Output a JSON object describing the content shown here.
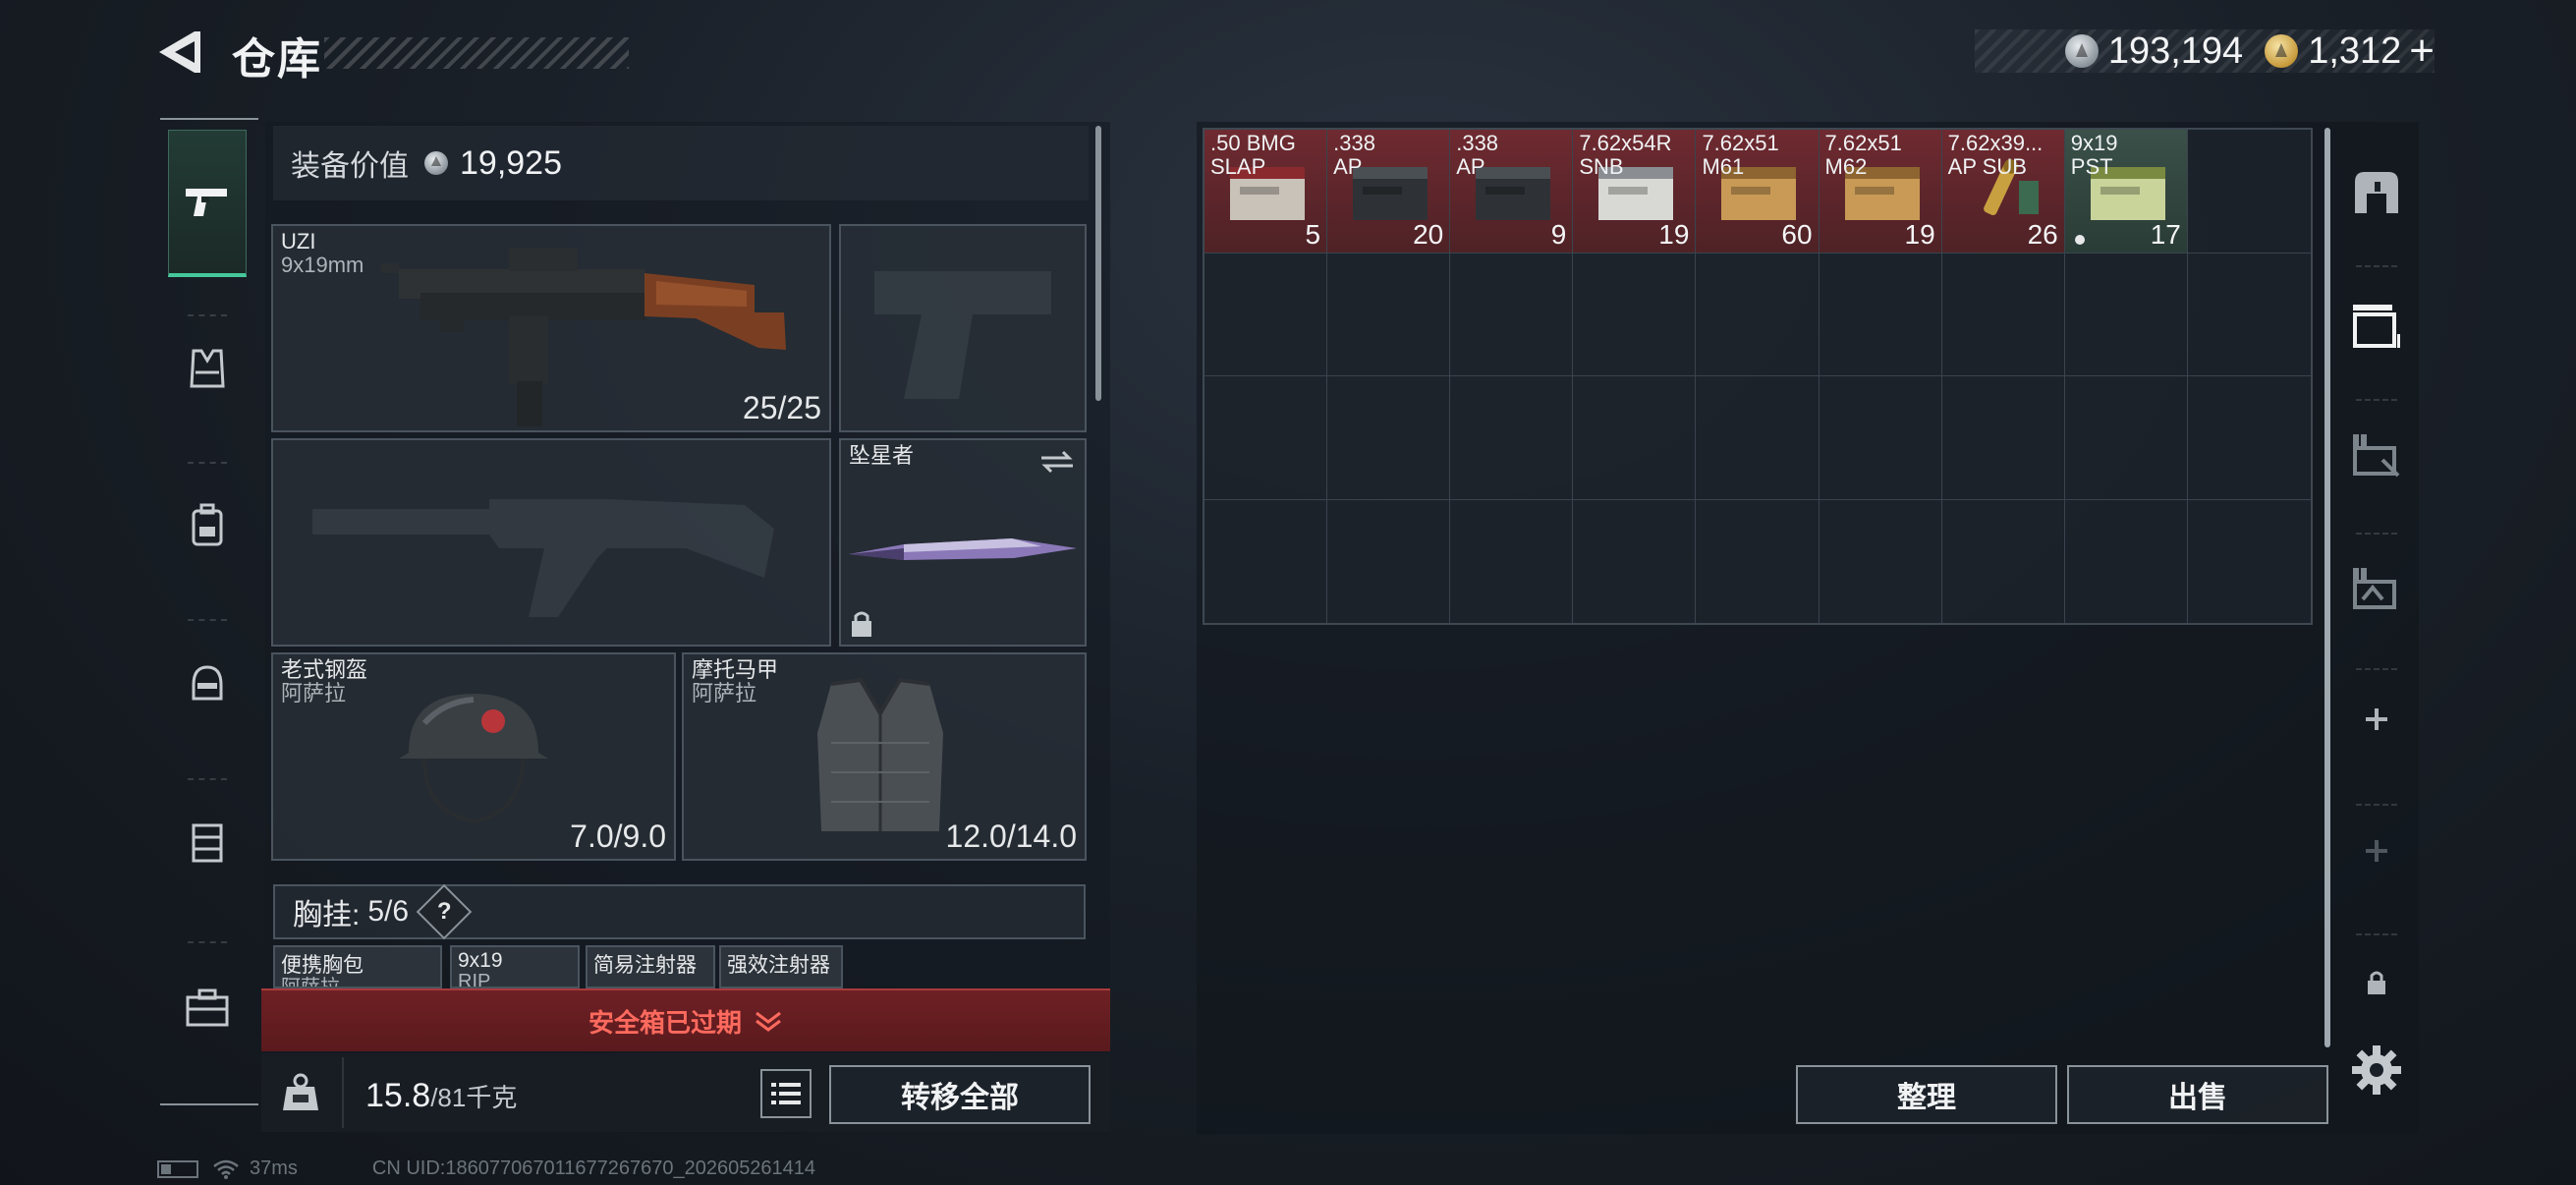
{
  "header": {
    "title": "仓库",
    "silver_amount": "193,194",
    "gold_amount": "1,312",
    "gold_plus": "+"
  },
  "left_nav": {
    "items": [
      {
        "name": "weapons",
        "icon": "pistol-icon",
        "active": true
      },
      {
        "name": "armor",
        "icon": "vest-icon",
        "active": false
      },
      {
        "name": "backpack",
        "icon": "backpack-icon",
        "active": false
      },
      {
        "name": "helmet",
        "icon": "helmet-icon",
        "active": false
      },
      {
        "name": "chest-rig",
        "icon": "rig-icon",
        "active": false
      },
      {
        "name": "case",
        "icon": "briefcase-icon",
        "active": false
      }
    ]
  },
  "equipment": {
    "value_label": "装备价值",
    "value": "19,925",
    "primary_weapon": {
      "name": "UZI",
      "caliber": "9x19mm",
      "ammo": "25/25"
    },
    "melee": {
      "name": "坠星者"
    },
    "helmet": {
      "name": "老式钢盔",
      "brand": "阿萨拉",
      "durability": "7.0/9.0"
    },
    "armor": {
      "name": "摩托马甲",
      "brand": "阿萨拉",
      "durability": "12.0/14.0"
    },
    "chest_rig": {
      "label": "胸挂:",
      "count": "5/6",
      "help": "?",
      "slots": [
        {
          "name": "便携胸包",
          "sub": "阿萨拉"
        },
        {
          "name": "9x19",
          "sub": "RIP"
        },
        {
          "name": "简易注射器",
          "sub": ""
        },
        {
          "name": "强效注射器",
          "sub": ""
        }
      ]
    }
  },
  "safebox": {
    "status": "安全箱已过期",
    "chevron": "⌄"
  },
  "weight": {
    "current": "15.8",
    "max": "/81千克"
  },
  "buttons": {
    "transfer_all": "转移全部",
    "sort": "整理",
    "sell": "出售"
  },
  "status_bar": {
    "ping": "37ms",
    "uid": "CN UID:186077067011677267670_202605261414"
  },
  "storage": {
    "columns": 9,
    "rows": 4,
    "items": [
      {
        "name": ".50 BMG",
        "type": "SLAP",
        "count": "5",
        "style": "red",
        "icon": "ammo-box-red"
      },
      {
        "name": ".338",
        "type": "AP",
        "count": "20",
        "style": "red",
        "icon": "ammo-box-dark"
      },
      {
        "name": ".338",
        "type": "AP",
        "count": "9",
        "style": "red",
        "icon": "ammo-box-dark"
      },
      {
        "name": "7.62x54R",
        "type": "SNB",
        "count": "19",
        "style": "red",
        "icon": "ammo-box-white"
      },
      {
        "name": "7.62x51",
        "type": "M61",
        "count": "60",
        "style": "red",
        "icon": "ammo-box-tan"
      },
      {
        "name": "7.62x51",
        "type": "M62",
        "count": "19",
        "style": "red",
        "icon": "ammo-box-tan"
      },
      {
        "name": "7.62x39...",
        "type": "AP SUB",
        "count": "26",
        "style": "red",
        "icon": "rounds-loose"
      },
      {
        "name": "9x19",
        "type": "PST",
        "count": "17",
        "style": "green",
        "icon": "ammo-box-green",
        "marked": true
      }
    ]
  },
  "colors": {
    "accent_green": "#46c89a",
    "warning_red": "#ff6a5e",
    "item_red_bg": "#6e2a30",
    "item_green_bg": "#3a5048"
  }
}
